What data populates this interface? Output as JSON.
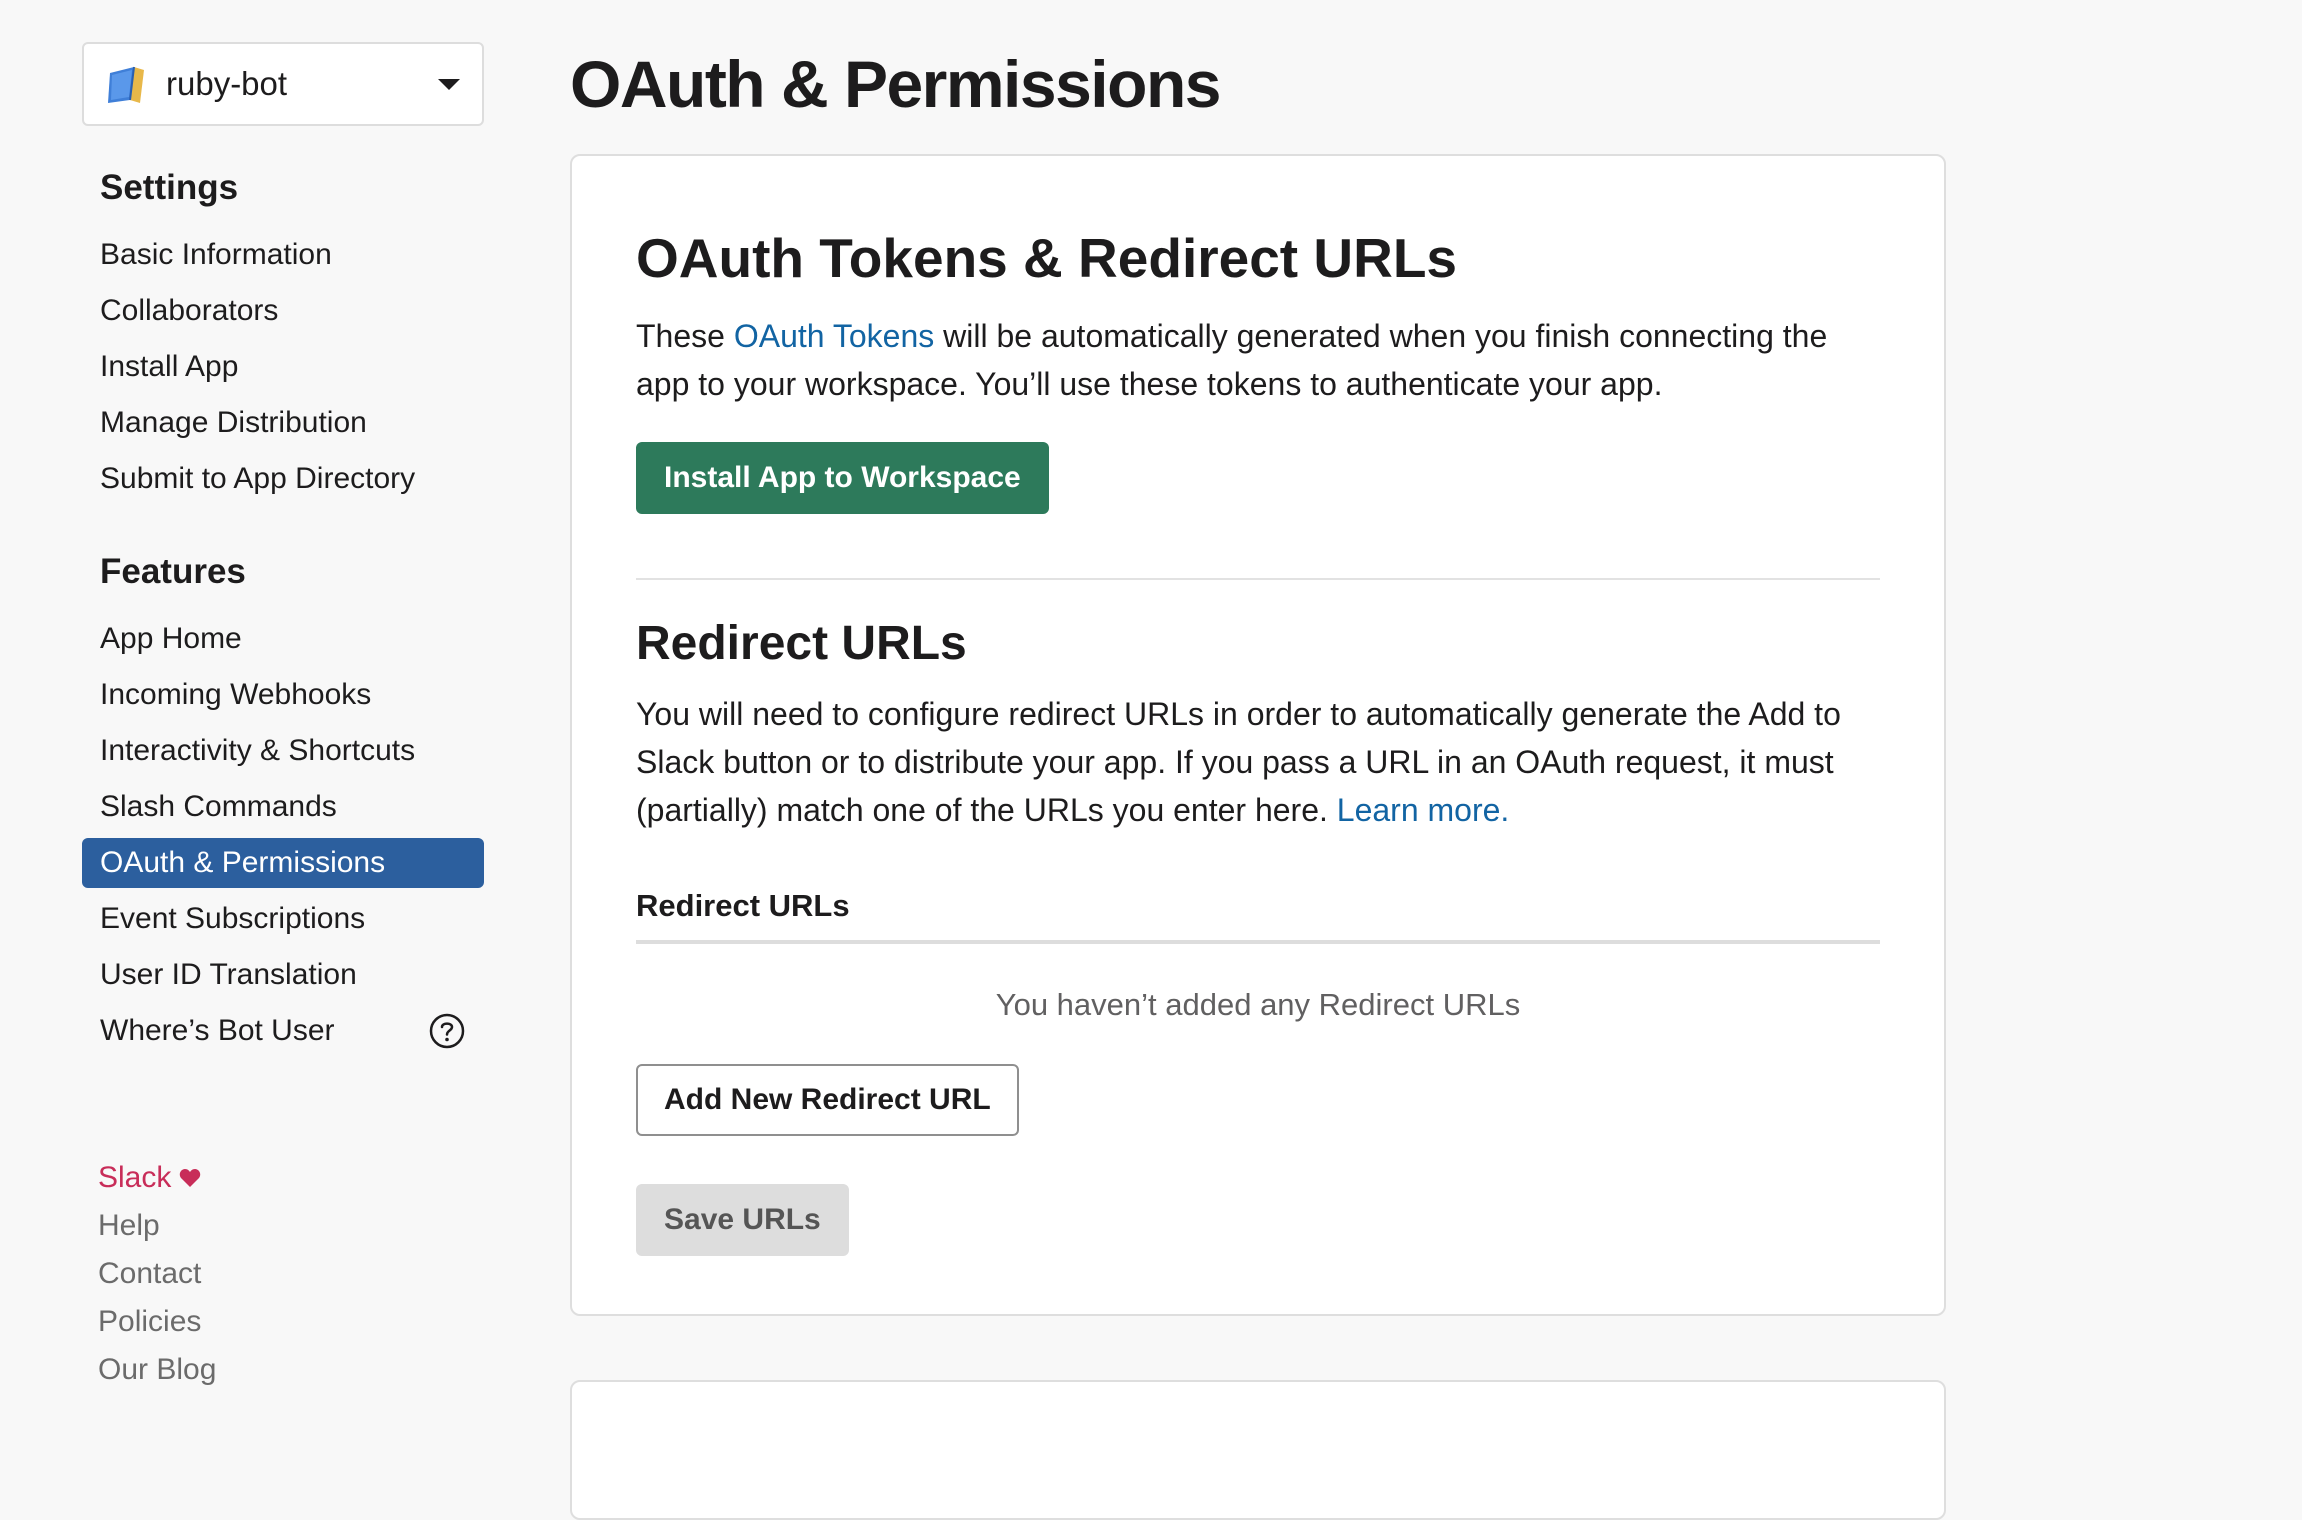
{
  "app_switcher": {
    "name": "ruby-bot",
    "icon": "book-icon"
  },
  "sidebar": {
    "settings_heading": "Settings",
    "settings_items": [
      {
        "label": "Basic Information"
      },
      {
        "label": "Collaborators"
      },
      {
        "label": "Install App"
      },
      {
        "label": "Manage Distribution"
      },
      {
        "label": "Submit to App Directory"
      }
    ],
    "features_heading": "Features",
    "features_items": [
      {
        "label": "App Home"
      },
      {
        "label": "Incoming Webhooks"
      },
      {
        "label": "Interactivity & Shortcuts"
      },
      {
        "label": "Slash Commands"
      },
      {
        "label": "OAuth & Permissions",
        "active": true
      },
      {
        "label": "Event Subscriptions"
      },
      {
        "label": "User ID Translation"
      },
      {
        "label": "Where’s Bot User",
        "icon": "question-circle-icon"
      }
    ],
    "footer": {
      "slack": "Slack",
      "help": "Help",
      "contact": "Contact",
      "policies": "Policies",
      "blog": "Our Blog"
    },
    "active_color": "#2c5f9e"
  },
  "page": {
    "title": "OAuth & Permissions"
  },
  "tokens_section": {
    "title": "OAuth Tokens & Redirect URLs",
    "text_before": "These ",
    "link": "OAuth Tokens",
    "text_after": " will be automatically generated when you finish connecting the app to your workspace. You’ll use these tokens to authenticate your app.",
    "install_button": "Install App to Workspace",
    "install_button_color": "#2d7a5b"
  },
  "redirect_section": {
    "title": "Redirect URLs",
    "text": "You will need to configure redirect URLs in order to automatically generate the Add to Slack button or to distribute your app. If you pass a URL in an OAuth request, it must (partially) match one of the URLs you enter here. ",
    "learn_more": "Learn more.",
    "list_heading": "Redirect URLs",
    "empty_message": "You haven’t added any Redirect URLs",
    "add_button": "Add New Redirect URL",
    "save_button": "Save URLs"
  }
}
